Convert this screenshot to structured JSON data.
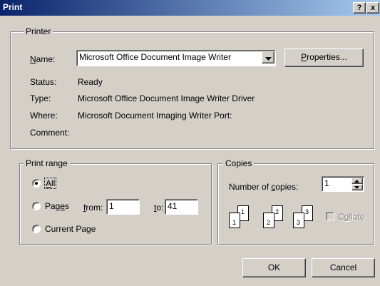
{
  "window": {
    "title": "Print",
    "help_glyph": "?",
    "close_glyph": "x"
  },
  "printer": {
    "group_label": "Printer",
    "name_label": "Name:",
    "name_label_accel": "N",
    "name_label_rest": "ame:",
    "name_value": "Microsoft Office Document Image Writer",
    "properties_accel": "P",
    "properties_rest": "roperties...",
    "status_label": "Status:",
    "status_value": "Ready",
    "type_label": "Type:",
    "type_value": "Microsoft Office Document Image Writer Driver",
    "where_label": "Where:",
    "where_value": "Microsoft Document Imaging Writer Port:",
    "comment_label": "Comment:",
    "comment_value": ""
  },
  "print_range": {
    "group_label": "Print range",
    "all_accel": "A",
    "all_rest": "ll",
    "pages_pre": "Pag",
    "pages_accel": "e",
    "pages_post": "s",
    "from_accel": "f",
    "from_rest": "rom:",
    "from_value": "1",
    "to_accel": "t",
    "to_rest": "o:",
    "to_value": "41",
    "current_page": "Current Page",
    "selected": "all"
  },
  "copies": {
    "group_label": "Copies",
    "number_pre": "Number of ",
    "number_accel": "c",
    "number_post": "opies:",
    "number_value": "1",
    "collate_accel": "o",
    "collate_pre": "C",
    "collate_post": "llate",
    "collate_checked": false,
    "page_icons": [
      "1",
      "1",
      "2",
      "2",
      "3",
      "3"
    ]
  },
  "buttons": {
    "ok": "OK",
    "cancel": "Cancel"
  },
  "colors": {
    "titlebar_start": "#0a246a",
    "titlebar_end": "#a6caf0",
    "dialog_bg": "#d4d0c8"
  }
}
